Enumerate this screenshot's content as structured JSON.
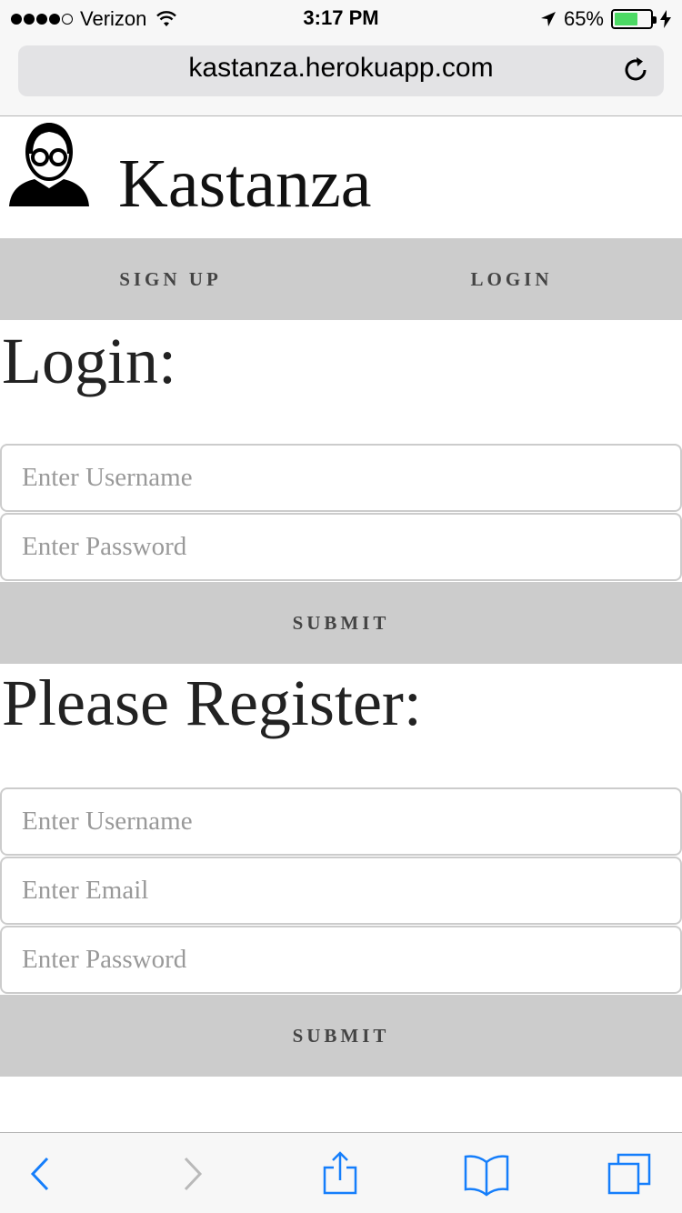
{
  "status_bar": {
    "carrier": "Verizon",
    "time": "3:17 PM",
    "battery_percent": "65%",
    "battery_level": 0.65,
    "signal_bars_filled": 4,
    "signal_bars_total": 5
  },
  "browser": {
    "url": "kastanza.herokuapp.com"
  },
  "site": {
    "title": "Kastanza"
  },
  "nav": {
    "items": [
      {
        "label": "SIGN UP"
      },
      {
        "label": "LOGIN"
      }
    ]
  },
  "login": {
    "heading": "Login:",
    "username_placeholder": "Enter Username",
    "password_placeholder": "Enter Password",
    "submit_label": "SUBMIT"
  },
  "register": {
    "heading": "Please Register:",
    "username_placeholder": "Enter Username",
    "email_placeholder": "Enter Email",
    "password_placeholder": "Enter Password",
    "submit_label": "SUBMIT"
  },
  "colors": {
    "ios_blue": "#157efb",
    "nav_bg": "#cccccc",
    "battery_green": "#4cd964"
  },
  "toolbar": {
    "icons": [
      "back-icon",
      "forward-icon",
      "share-icon",
      "bookmarks-icon",
      "tabs-icon"
    ]
  }
}
